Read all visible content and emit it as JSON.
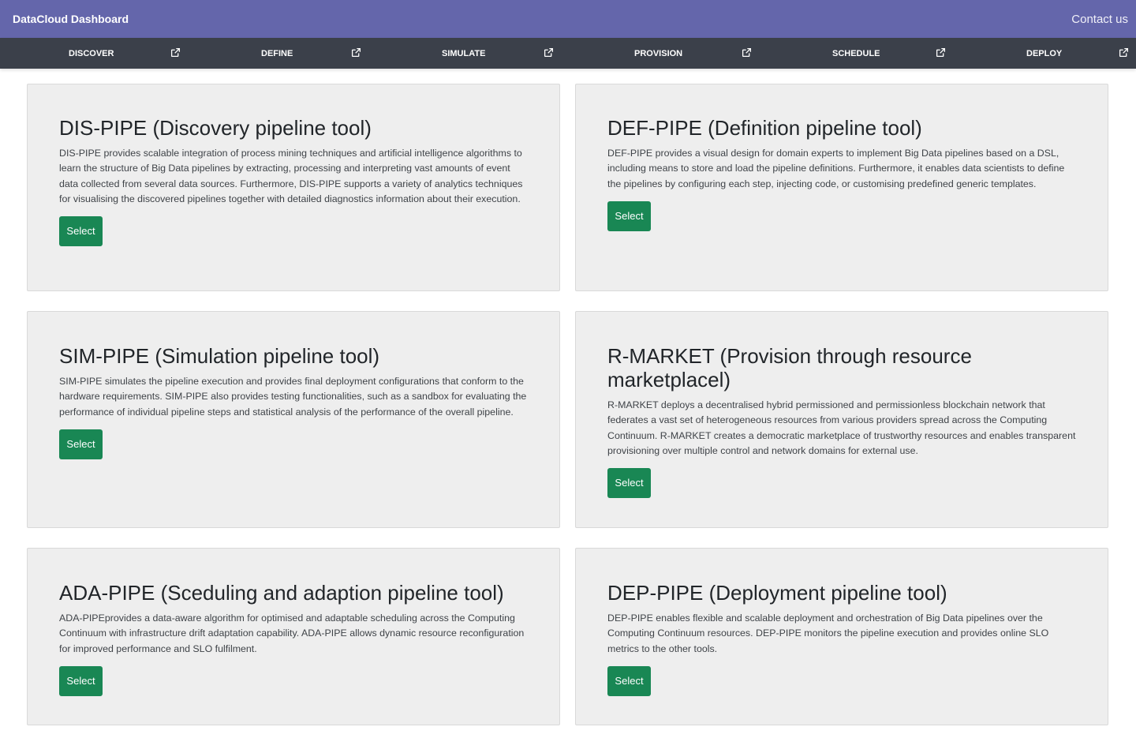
{
  "header": {
    "brand": "DataCloud Dashboard",
    "contact_label": "Contact us"
  },
  "nav": {
    "items": [
      {
        "label": "DISCOVER",
        "icon": "external-link-icon"
      },
      {
        "label": "DEFINE",
        "icon": "external-link-icon"
      },
      {
        "label": "SIMULATE",
        "icon": "external-link-icon"
      },
      {
        "label": "PROVISION",
        "icon": "external-link-icon"
      },
      {
        "label": "SCHEDULE",
        "icon": "external-link-icon"
      },
      {
        "label": "DEPLOY",
        "icon": "external-link-icon"
      }
    ]
  },
  "cards": [
    {
      "title": "DIS-PIPE (Discovery pipeline tool)",
      "description": "DIS-PIPE provides scalable integration of process mining techniques and artificial intelligence algorithms to learn the structure of Big Data pipelines by extracting, processing and interpreting vast amounts of event data collected from several data sources. Furthermore, DIS-PIPE supports a variety of analytics techniques for visualising the discovered pipelines together with detailed diagnostics information about their execution.",
      "button": "Select"
    },
    {
      "title": "DEF-PIPE (Definition pipeline tool)",
      "description": "DEF-PIPE provides a visual design for domain experts to implement Big Data pipelines based on a DSL, including means to store and load the pipeline definitions. Furthermore, it enables data scientists to define the pipelines by configuring each step, injecting code, or customising predefined generic templates.",
      "button": "Select"
    },
    {
      "title": "SIM-PIPE (Simulation pipeline tool)",
      "description": "SIM-PIPE simulates the pipeline execution and provides final deployment configurations that conform to the hardware requirements. SIM-PIPE also provides testing functionalities, such as a sandbox for evaluating the performance of individual pipeline steps and statistical analysis of the performance of the overall pipeline.",
      "button": "Select"
    },
    {
      "title": "R-MARKET (Provision through resource marketplacel)",
      "description": "R-MARKET deploys a decentralised hybrid permissioned and permissionless blockchain network that federates a vast set of heterogeneous resources from various providers spread across the Computing Continuum. R-MARKET creates a democratic marketplace of trustworthy resources and enables transparent provisioning over multiple control and network domains for external use.",
      "button": "Select"
    },
    {
      "title": "ADA-PIPE (Sceduling and adaption pipeline tool)",
      "description": "ADA-PIPEprovides a data-aware algorithm for optimised and adaptable scheduling across the Computing Continuum with infrastructure drift adaptation capability. ADA-PIPE allows dynamic resource reconfiguration for improved performance and SLO fulfilment.",
      "button": "Select"
    },
    {
      "title": "DEP-PIPE (Deployment pipeline tool)",
      "description": "DEP-PIPE enables flexible and scalable deployment and orchestration of Big Data pipelines over the Computing Continuum resources. DEP-PIPE monitors the pipeline execution and provides online SLO metrics to the other tools.",
      "button": "Select"
    }
  ],
  "colors": {
    "header_bg": "#6466ab",
    "nav_bg": "#3b404a",
    "card_bg": "#eeeeee",
    "button_bg": "#198754"
  }
}
